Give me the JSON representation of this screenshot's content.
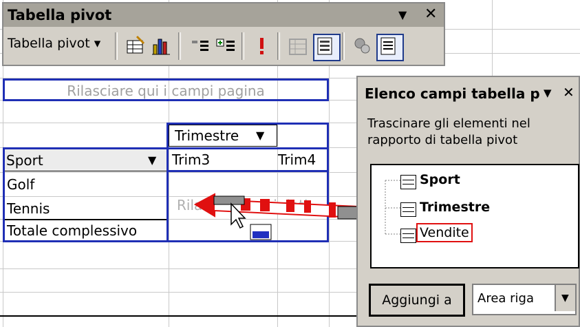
{
  "toolbar": {
    "title": "Tabella pivot",
    "menu_label": "Tabella pivot ▾",
    "menu_button_icon": "chevron-down-icon",
    "close_icon": "close-icon"
  },
  "sheet": {
    "page_drop_zone": "Rilasciare qui i campi pagina",
    "column_field": "Trimestre",
    "row_field": "Sport",
    "column_items": [
      "Trim3",
      "Trim4"
    ],
    "row_items": [
      "Golf",
      "Tennis"
    ],
    "grand_total": "Totale complessivo",
    "data_drop_zone": "Rilasciare qui i dati"
  },
  "field_list": {
    "title": "Elenco campi tabella p",
    "description_line1": "Trascinare gli elementi nel",
    "description_line2": "rapporto di tabella pivot",
    "fields": [
      "Sport",
      "Trimestre",
      "Vendite"
    ],
    "add_button": "Aggiungi a",
    "area_selected": "Area riga"
  },
  "colors": {
    "blue_border": "#1f2fb5",
    "drag_arrow": "#e01010",
    "panel_bg": "#d4d0c8"
  }
}
